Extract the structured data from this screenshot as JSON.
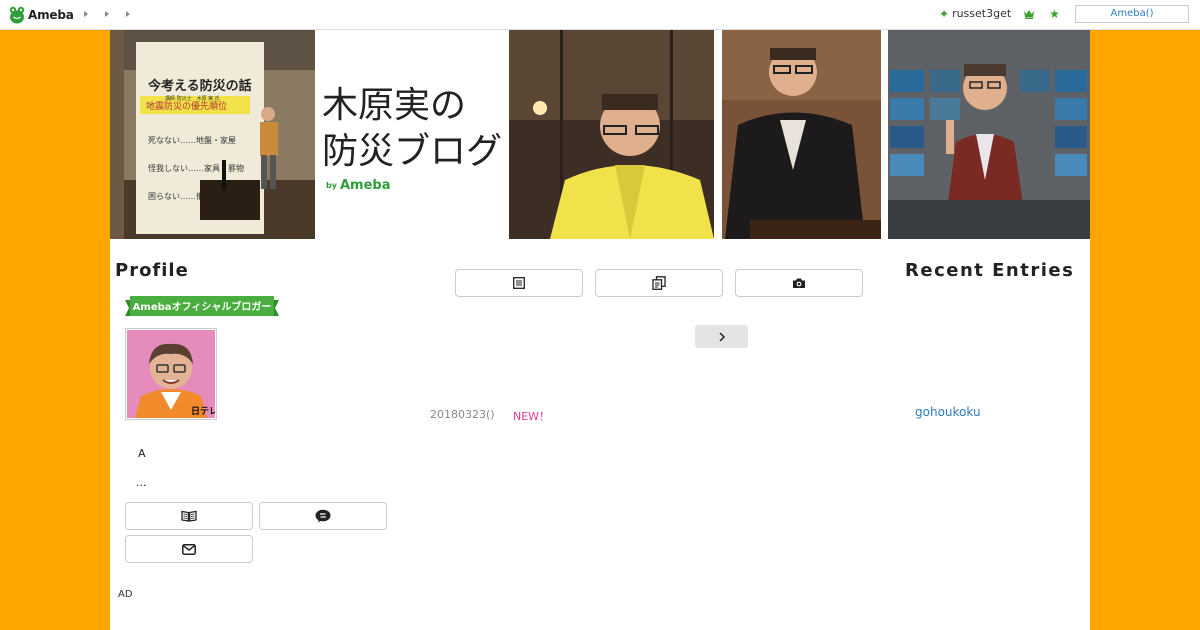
{
  "topbar": {
    "logo_text": "Ameba",
    "username": "russet3get",
    "ameba_button": "Ameba()",
    "icons": [
      "frog-logo-icon",
      "nav-arrow-icon",
      "sparkle-icon",
      "crown-icon",
      "star-icon"
    ]
  },
  "header": {
    "title_line1": "木原実の",
    "title_line2": "防災ブログ",
    "by_text": "by",
    "brand_text": "Ameba",
    "slide_title": "今考える防災の話",
    "slide_subtitle": "講師 防災士　木原 実 氏",
    "slide_heading": "地震防災の優先順位",
    "slide_item_a": "死なない……地盤・家屋",
    "slide_item_b": "怪我しない……家具・罫物",
    "slide_item_c": "困らない……備蓄"
  },
  "profile": {
    "heading": "Profile",
    "badge_text": "Amebaオフィシャルブロガー",
    "avatar_logo": "日テレ",
    "line_a": "A",
    "more": "...",
    "buttons": [
      "book-icon",
      "chat-icon",
      "mail-icon"
    ],
    "ad_label": "AD"
  },
  "center": {
    "tabs": [
      "list-icon",
      "copy-icon",
      "camera-icon"
    ],
    "next_icon": "chevron-right-icon",
    "entry_date": "20180323()",
    "entry_new": "NEW！"
  },
  "recent": {
    "heading": "Recent Entries",
    "link": "gohoukoku"
  },
  "colors": {
    "page_background": "#ffa500",
    "accent_green": "#3aa12d",
    "link_blue": "#2e7bbf",
    "new_pink": "#e03a91"
  }
}
